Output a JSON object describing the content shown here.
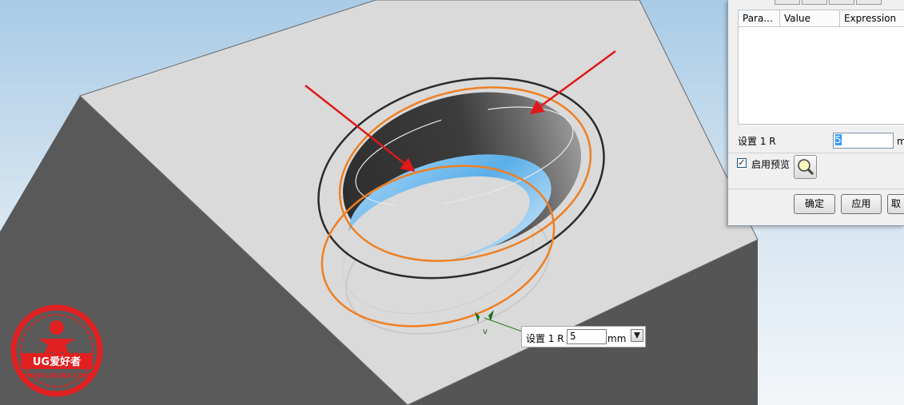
{
  "viewport": {
    "title": ""
  },
  "dialog": {
    "table": {
      "columns": [
        "Para...",
        "Value",
        "Expression"
      ]
    },
    "setting_label": "设置 1 R",
    "setting_value": "5",
    "unit": "mm",
    "preview_label": "启用预览",
    "preview_checked": true,
    "ok_label": "确定",
    "apply_label": "应用",
    "cancel_label": "取"
  },
  "onscreen_input": {
    "label": "设置 1 R",
    "value": "5",
    "unit": "mm"
  },
  "handle": {
    "label": "v"
  },
  "logo": {
    "text": "UG爱好者",
    "url": "WWW.UGSNX.COM"
  },
  "colors": {
    "background_top": "#b0d0e8",
    "background_bottom": "#f0f4f8",
    "block_top": "#dadada",
    "block_side": "#555555",
    "edge_highlight": "#ef7f22",
    "annotation_arrow": "#e01818",
    "fillet_blue": "#5aaee8"
  }
}
